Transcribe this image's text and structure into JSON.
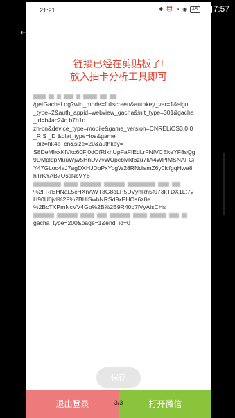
{
  "system_bar": {
    "time": "7:57"
  },
  "inner_status": {
    "time": "21:21",
    "icons": "✱ ⏰ ◔ ◉",
    "battery": "45"
  },
  "message": {
    "line1": "链接已经在剪贴板了!",
    "line2": "放入抽卡分析工具即可"
  },
  "url_lines": [
    {
      "pre": [
        18,
        8,
        6,
        14,
        6,
        20,
        10,
        10
      ],
      "text": ""
    },
    {
      "pre": [],
      "text": "/getGachaLog?win_mode=fullscreen&authkey_ver=1&sign"
    },
    {
      "pre": [],
      "text": "_type=2&auth_appid=webview_gacha&init_type=301&gacha"
    },
    {
      "pre": [],
      "text": "_id=b4ac24c          b7b1d                    "
    },
    {
      "pre": [],
      "text": "zh-cn&device_type=mobile&game_version=CNRELiOS3.0.0"
    },
    {
      "pre": [],
      "text": "_R          S          _D             &plat_type=ios&game"
    },
    {
      "pre": [],
      "text": "_biz=hk4e_cn&size=20&authkey="
    },
    {
      "pre": [],
      "text": "S8DeMIxxKlVkc60Fj0dOfRIkhUpFaFfEdLrFNfVCEkeYF8sQg"
    },
    {
      "pre": [],
      "text": "9DMpldpMuuWjw5HnDv7vWUpcbMkf6zu7liA4WPIMSNAFCj"
    },
    {
      "pre": [],
      "text": "Y47GLoc4aJ7agDXHJDbPxYpgW28RNdlsmZ6y0lcfgqHwa8"
    },
    {
      "pre": [],
      "text": "hTrKYAB7OssNcVY6"
    },
    {
      "pre": [
        40,
        20,
        30,
        30,
        40,
        16,
        12
      ],
      "text": ""
    },
    {
      "pre": [],
      "text": "%2FRrEHNaL5cHXnAWT3G8oLP5DVyhRh5f073kTDX1Lt7y"
    },
    {
      "pre": [],
      "text": "H90U0jvl%2F%2BHiSwbNRSd9xPHOs6z8e"
    },
    {
      "pre": [],
      "text": "%2BcTXPmNcVV4Gb%2B%2B9R40b7lVyAlsCHs"
    },
    {
      "pre": [
        30,
        30,
        20,
        14,
        30,
        20,
        24,
        14,
        8
      ],
      "text": ""
    },
    {
      "pre": [],
      "text": "gacha_type=200&page=1&end_id=0"
    }
  ],
  "buttons": {
    "save": "保存",
    "logout": "退出登录",
    "open_wechat": "打开微信"
  },
  "pager": "3/3",
  "colors": {
    "headline": "#e2412f",
    "logout_bg": "#ee7b7b",
    "wechat_bg": "#8ac33c",
    "save_bg": "#e6e6e6"
  }
}
